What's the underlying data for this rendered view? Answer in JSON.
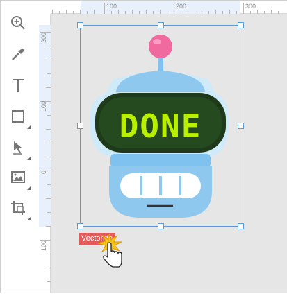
{
  "toolbar": {
    "tools": [
      {
        "icon": "zoom-in-icon"
      },
      {
        "icon": "color-picker-icon"
      },
      {
        "icon": "text-tool-icon"
      },
      {
        "icon": "rectangle-tool-icon"
      },
      {
        "icon": "pen-tool-icon"
      },
      {
        "icon": "image-tool-icon"
      },
      {
        "icon": "crop-tool-icon"
      }
    ]
  },
  "ruler": {
    "top_labels": [
      "100",
      "200",
      "300"
    ],
    "left_labels": [
      "200",
      "100",
      "0",
      "100"
    ]
  },
  "artwork": {
    "name": "robot-illustration",
    "screen_text": "DONE",
    "colors": {
      "body": "#8ec8ef",
      "outline": "#7dc0ee",
      "screen": "#1f3a1a",
      "screen_text": "#b8f000",
      "antenna_ball": "#f06aa0",
      "mouth": "#ffffff",
      "selection": "#5b9bd5"
    }
  },
  "action_badge": {
    "label": "Vectorize",
    "color": "#e55a5a"
  }
}
